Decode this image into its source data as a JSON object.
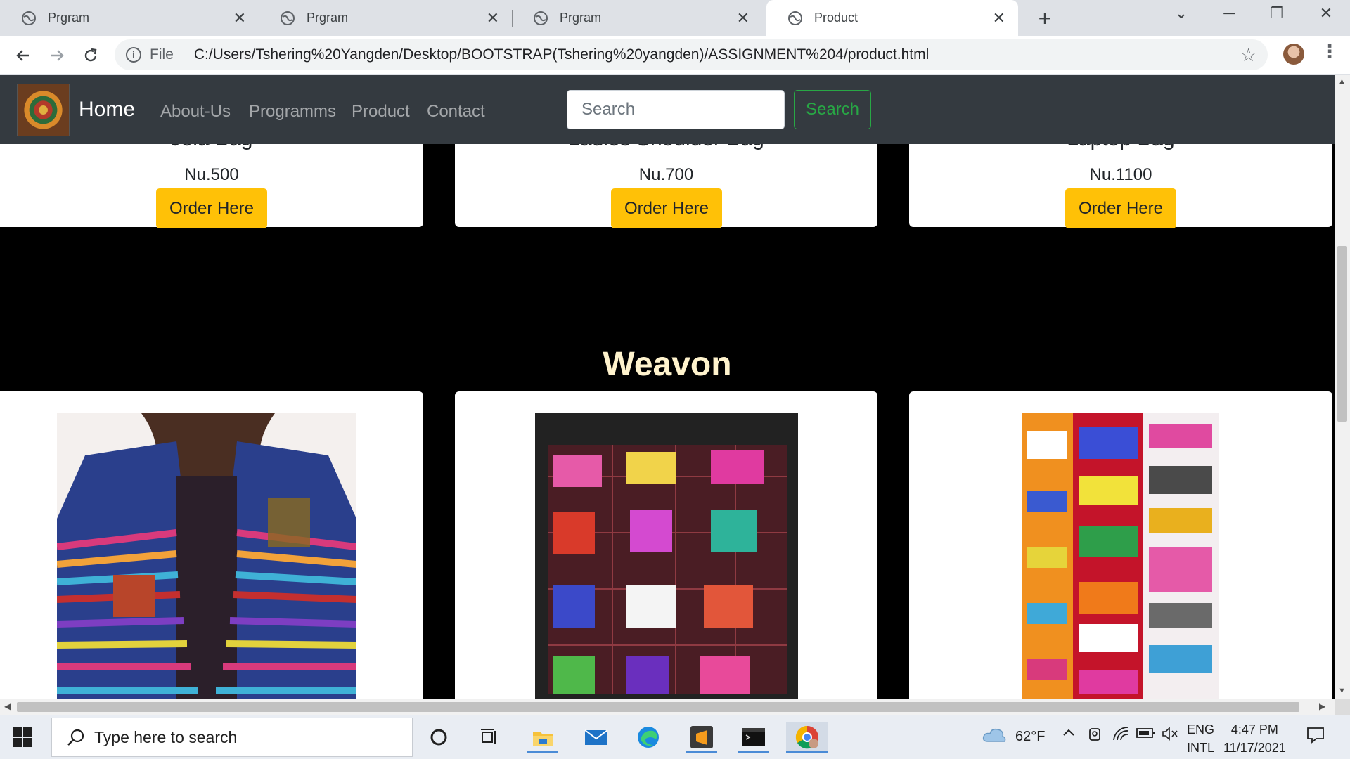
{
  "browser": {
    "tabs": [
      {
        "title": "Prgram"
      },
      {
        "title": "Prgram"
      },
      {
        "title": "Prgram"
      },
      {
        "title": "Product"
      }
    ],
    "address": {
      "scheme": "File",
      "url": "C:/Users/Tshering%20Yangden/Desktop/BOOTSTRAP(Tshering%20yangden)/ASSIGNMENT%204/product.html"
    }
  },
  "navbar": {
    "brand": "Home",
    "links": [
      "About-Us",
      "Programms",
      "Product",
      "Contact"
    ],
    "search_placeholder": "Search",
    "search_button": "Search"
  },
  "bags": [
    {
      "name": "Jola Bag",
      "price": "Nu.500",
      "button": "Order Here"
    },
    {
      "name": "Ladies Shoulder Bag",
      "price": "Nu.700",
      "button": "Order Here"
    },
    {
      "name": "Laptop Bag",
      "price": "Nu.1100",
      "button": "Order Here"
    }
  ],
  "woven_section": {
    "title": "Weavon"
  },
  "taskbar": {
    "search_placeholder": "Type here to search",
    "weather": "62°F",
    "lang_top": "ENG",
    "lang_bottom": "INTL",
    "time": "4:47 PM",
    "date": "11/17/2021"
  },
  "colors": {
    "navbar_bg": "#343a40",
    "order_button": "#ffc107",
    "search_button": "#28a745",
    "section_title": "#fff3cd"
  }
}
